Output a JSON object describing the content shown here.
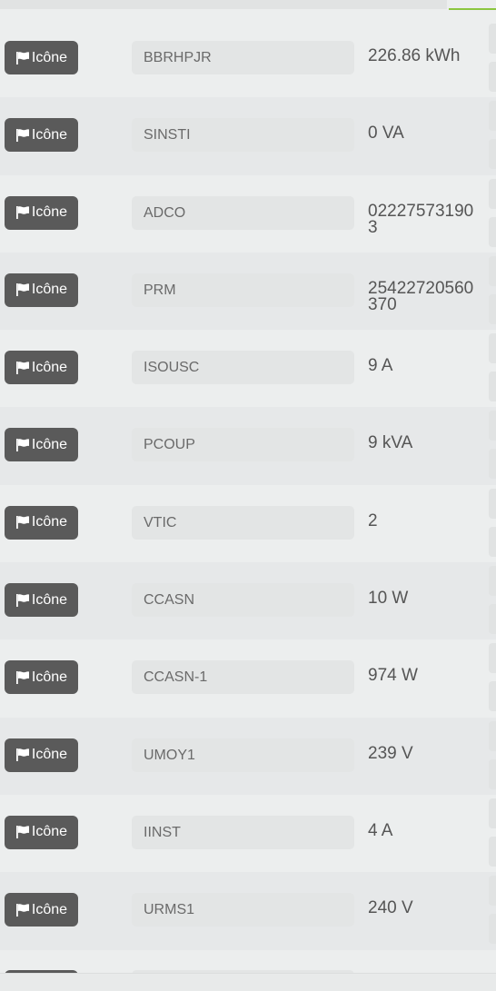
{
  "rows": [
    {
      "button_label": "Icône",
      "name": "BBRHPJR",
      "value": "226.86 kWh"
    },
    {
      "button_label": "Icône",
      "name": "SINSTI",
      "value": "0 VA"
    },
    {
      "button_label": "Icône",
      "name": "ADCO",
      "value": "022275731903"
    },
    {
      "button_label": "Icône",
      "name": "PRM",
      "value": "25422720560370"
    },
    {
      "button_label": "Icône",
      "name": "ISOUSC",
      "value": "9 A"
    },
    {
      "button_label": "Icône",
      "name": "PCOUP",
      "value": "9 kVA"
    },
    {
      "button_label": "Icône",
      "name": "VTIC",
      "value": "2"
    },
    {
      "button_label": "Icône",
      "name": "CCASN",
      "value": "10 W"
    },
    {
      "button_label": "Icône",
      "name": "CCASN-1",
      "value": "974 W"
    },
    {
      "button_label": "Icône",
      "name": "UMOY1",
      "value": "239 V"
    },
    {
      "button_label": "Icône",
      "name": "IINST",
      "value": "4 A"
    },
    {
      "button_label": "Icône",
      "name": "URMS1",
      "value": "240 V"
    }
  ],
  "icons": {
    "button_icon": "flag-icon"
  },
  "colors": {
    "button_bg": "#5a5a5a",
    "accent": "#8cc63f",
    "value_text": "#555555",
    "name_text": "#6a6a6a"
  }
}
